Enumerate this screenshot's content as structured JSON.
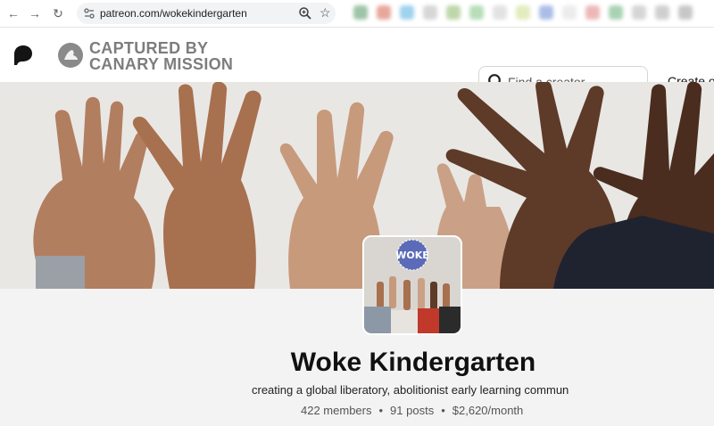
{
  "browser": {
    "url": "patreon.com/wokekindergarten"
  },
  "header": {
    "watermark_line1": "CAPTURED BY",
    "watermark_line2": "CANARY MISSION",
    "search_placeholder": "Find a creator",
    "create_label": "Create o"
  },
  "avatar": {
    "sign_text": "WOKE"
  },
  "profile": {
    "name": "Woke Kindergarten",
    "tagline": "creating a global liberatory, abolitionist early learning commun",
    "members": "422 members",
    "posts": "91 posts",
    "income": "$2,620/month"
  },
  "colors": {
    "brand_black": "#141414",
    "page_bg": "#f3f3f3",
    "watermark_gray": "#7d7d7d"
  }
}
